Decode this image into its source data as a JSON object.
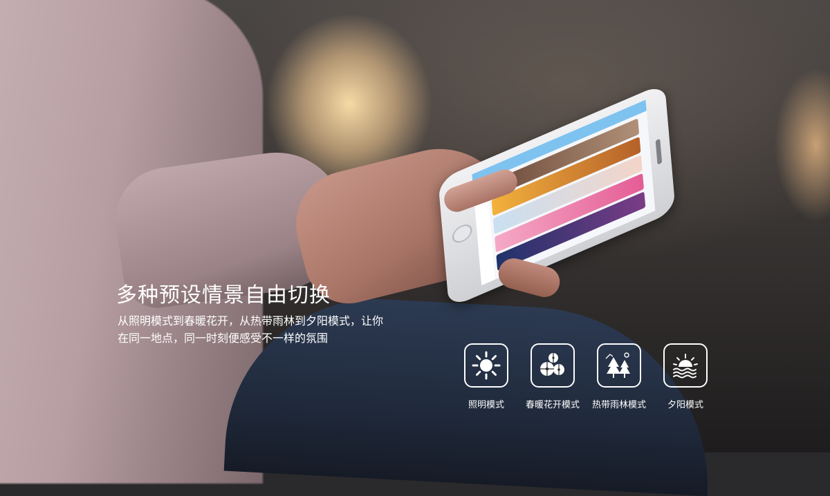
{
  "banner": {
    "headline": "多种预设情景自由切换",
    "description_lines": [
      "从照明模式到春暖花开，从热带雨林到夕阳模式，让你",
      "在同一地点，同一时刻便感受不一样的氛围"
    ]
  },
  "modes": [
    {
      "label": "照明模式",
      "icon": "sun-icon"
    },
    {
      "label": "春暖花开模式",
      "icon": "flowers-icon"
    },
    {
      "label": "热带雨林模式",
      "icon": "trees-icon"
    },
    {
      "label": "夕阳模式",
      "icon": "sunset-icon"
    }
  ],
  "colors": {
    "text": "#ffffff",
    "phone_header": "#7ec2f0"
  }
}
